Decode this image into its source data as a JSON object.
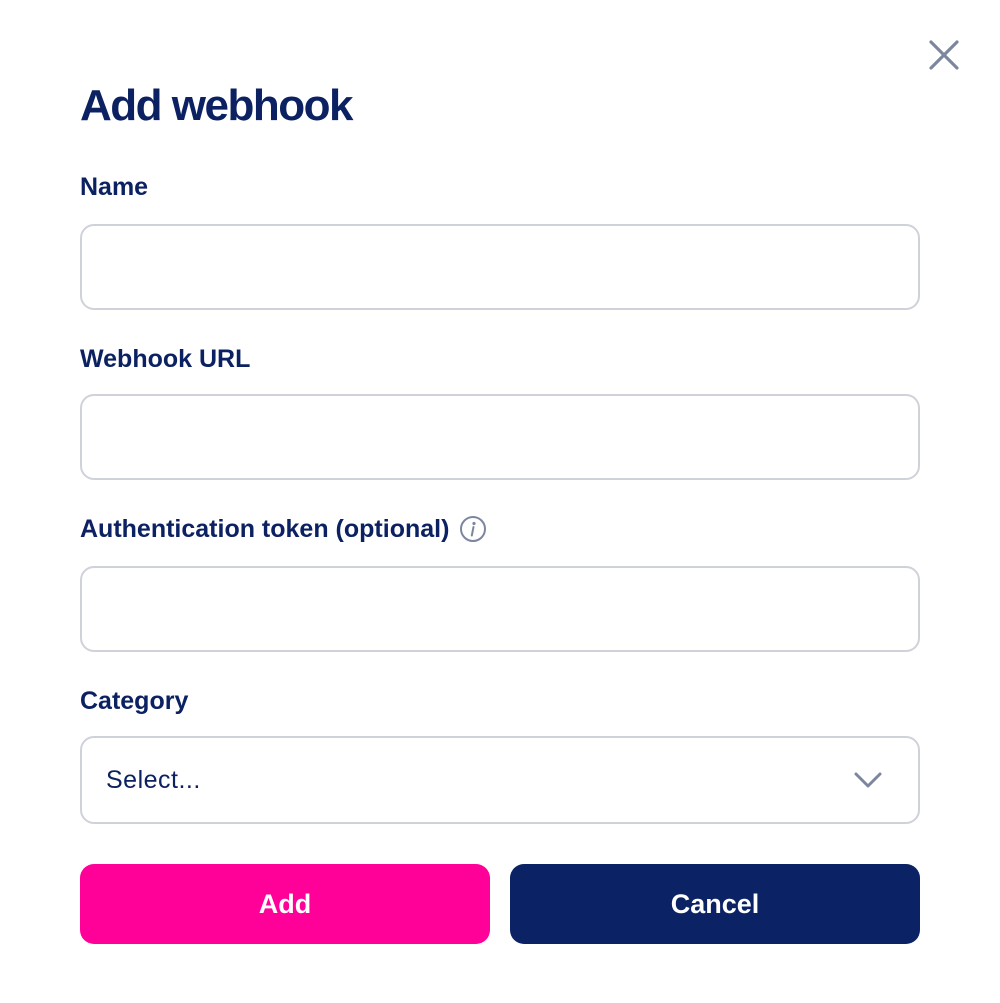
{
  "dialog": {
    "title": "Add webhook",
    "close_icon": "close-icon"
  },
  "fields": {
    "name": {
      "label": "Name",
      "value": "",
      "placeholder": ""
    },
    "webhook_url": {
      "label": "Webhook URL",
      "value": "",
      "placeholder": ""
    },
    "auth_token": {
      "label": "Authentication token (optional)",
      "value": "",
      "placeholder": "",
      "info_icon": "info-icon"
    },
    "category": {
      "label": "Category",
      "selected": "Select...",
      "icon": "chevron-down-icon"
    }
  },
  "actions": {
    "add_label": "Add",
    "cancel_label": "Cancel"
  },
  "colors": {
    "text": "#0b2161",
    "primary": "#ff0099",
    "secondary": "#0b2265",
    "border": "#cfd2d8",
    "icon": "#7c879f"
  }
}
